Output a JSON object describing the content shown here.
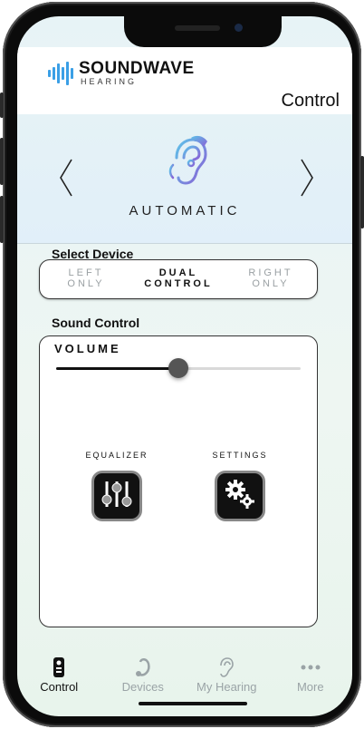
{
  "header": {
    "brand": "SOUNDWAVE",
    "brand_sub": "HEARING",
    "page_title": "Control"
  },
  "carousel": {
    "prev_icon": "chevron-left",
    "next_icon": "chevron-right",
    "mode_icon": "ear-hearing-aid-icon",
    "mode_label": "AUTOMATIC",
    "prev_glyph": "〈",
    "next_glyph": "〉"
  },
  "select_device": {
    "label": "Select Device",
    "options": [
      {
        "line1": "LEFT",
        "line2": "ONLY",
        "active": false
      },
      {
        "line1": "DUAL",
        "line2": "CONTROL",
        "active": true
      },
      {
        "line1": "RIGHT",
        "line2": "ONLY",
        "active": false
      }
    ]
  },
  "sound_control": {
    "label": "Sound Control",
    "volume_label": "VOLUME",
    "volume_fraction": 0.5,
    "equalizer_label": "EQUALIZER",
    "settings_label": "SETTINGS"
  },
  "tabbar": {
    "items": [
      {
        "label": "Control",
        "icon": "remote-icon",
        "active": true
      },
      {
        "label": "Devices",
        "icon": "hearing-aid-icon",
        "active": false
      },
      {
        "label": "My Hearing",
        "icon": "ear-icon",
        "active": false
      },
      {
        "label": "More",
        "icon": "ellipsis-icon",
        "active": false
      }
    ]
  },
  "colors": {
    "accent": "#3a9fe6",
    "ear_gradient_start": "#5ec2e8",
    "ear_gradient_end": "#8a5fd6",
    "text_dark": "#111111",
    "text_inactive": "#9aa0a3"
  }
}
